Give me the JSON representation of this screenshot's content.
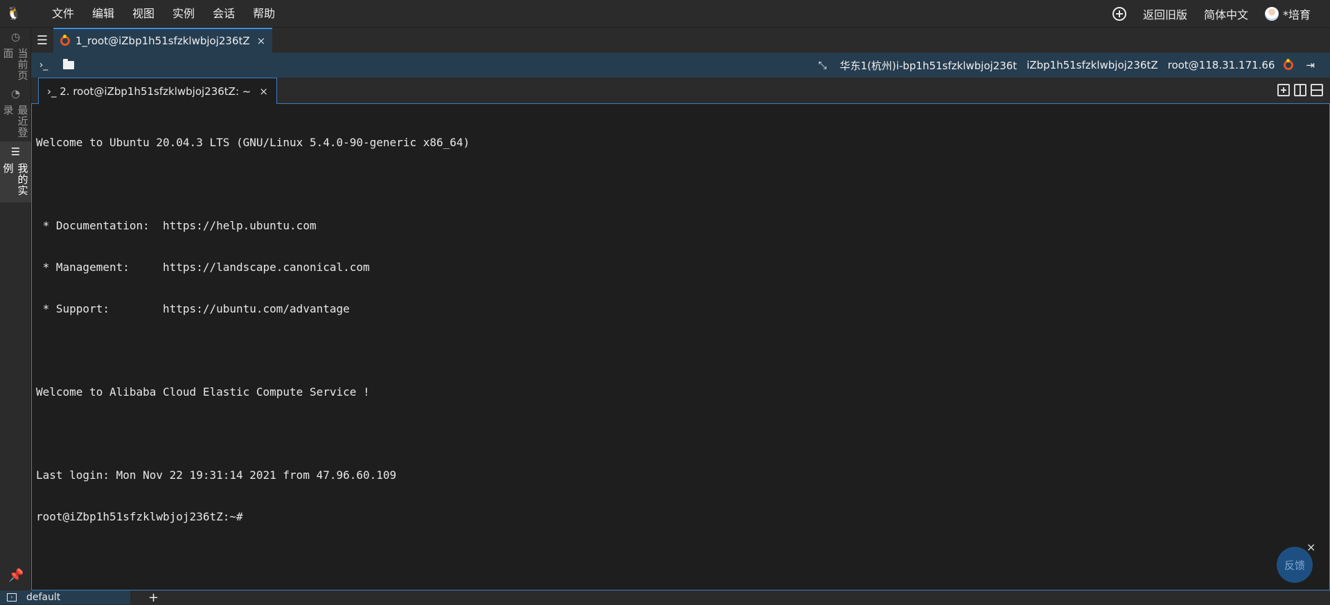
{
  "menubar": {
    "logo_icon": "linux-penguin-icon",
    "menu_items": [
      "文件",
      "编辑",
      "视图",
      "实例",
      "会话",
      "帮助"
    ],
    "right": {
      "add_icon": "plus-circle-icon",
      "back_old": "返回旧版",
      "language": "简体中文",
      "user": "*培育"
    }
  },
  "leftbar": {
    "tabs": [
      {
        "label": "当前页面",
        "icon": "clock-icon"
      },
      {
        "label": "最近登录",
        "icon": "history-icon"
      },
      {
        "label": "我的实例",
        "icon": "list-icon"
      }
    ],
    "pin_icon": "pin-icon"
  },
  "sessionbar": {
    "list_icon": "outline-list-icon",
    "tab_label": "1_root@iZbp1h51sfzklwbjoj236tZ",
    "close": "×"
  },
  "toolbar": {
    "terminal_icon": "›_",
    "region_instance": "华东1(杭州)i-bp1h51sfzklwbjoj236t",
    "hostname": "iZbp1h51sfzklwbjoj236tZ",
    "login": "root@118.31.171.66"
  },
  "termtab": {
    "label": "›_  2. root@iZbp1h51sfzklwbjoj236tZ: ~",
    "close": "×"
  },
  "terminal": {
    "lines": [
      "Welcome to Ubuntu 20.04.3 LTS (GNU/Linux 5.4.0-90-generic x86_64)",
      "",
      " * Documentation:  https://help.ubuntu.com",
      " * Management:     https://landscape.canonical.com",
      " * Support:        https://ubuntu.com/advantage",
      "",
      "Welcome to Alibaba Cloud Elastic Compute Service !",
      "",
      "Last login: Mon Nov 22 19:31:14 2021 from 47.96.60.109",
      "root@iZbp1h51sfzklwbjoj236tZ:~#"
    ]
  },
  "feedback": {
    "label": "反馈",
    "close": "×"
  },
  "bottombar": {
    "workspace": "default",
    "add": "+"
  }
}
